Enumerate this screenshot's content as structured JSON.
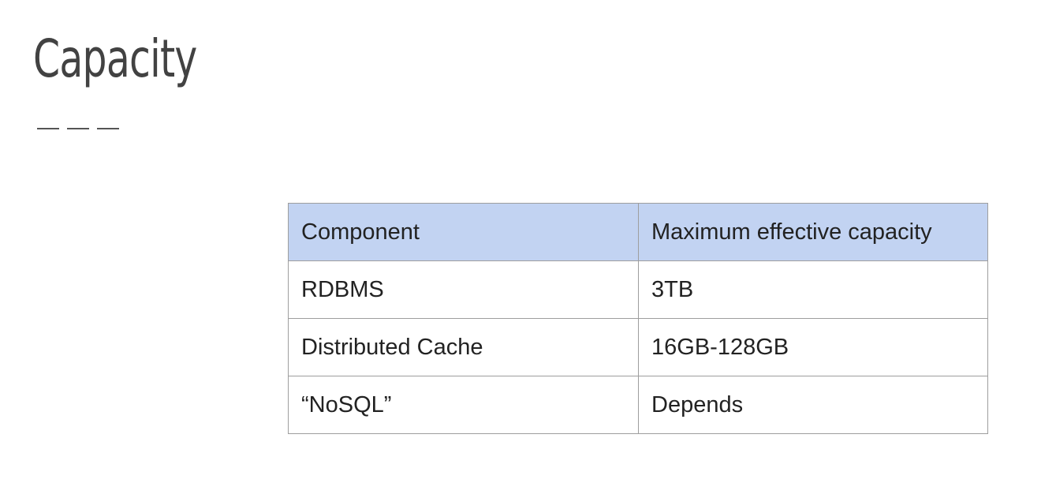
{
  "slide": {
    "title": "Capacity"
  },
  "table": {
    "headers": [
      "Component",
      "Maximum effective capacity"
    ],
    "rows": [
      [
        "RDBMS",
        "3TB"
      ],
      [
        "Distributed Cache",
        "16GB-128GB"
      ],
      [
        "“NoSQL”",
        "Depends"
      ]
    ],
    "header_bg": "#c2d3f2",
    "border_color": "#9e9e9e"
  }
}
